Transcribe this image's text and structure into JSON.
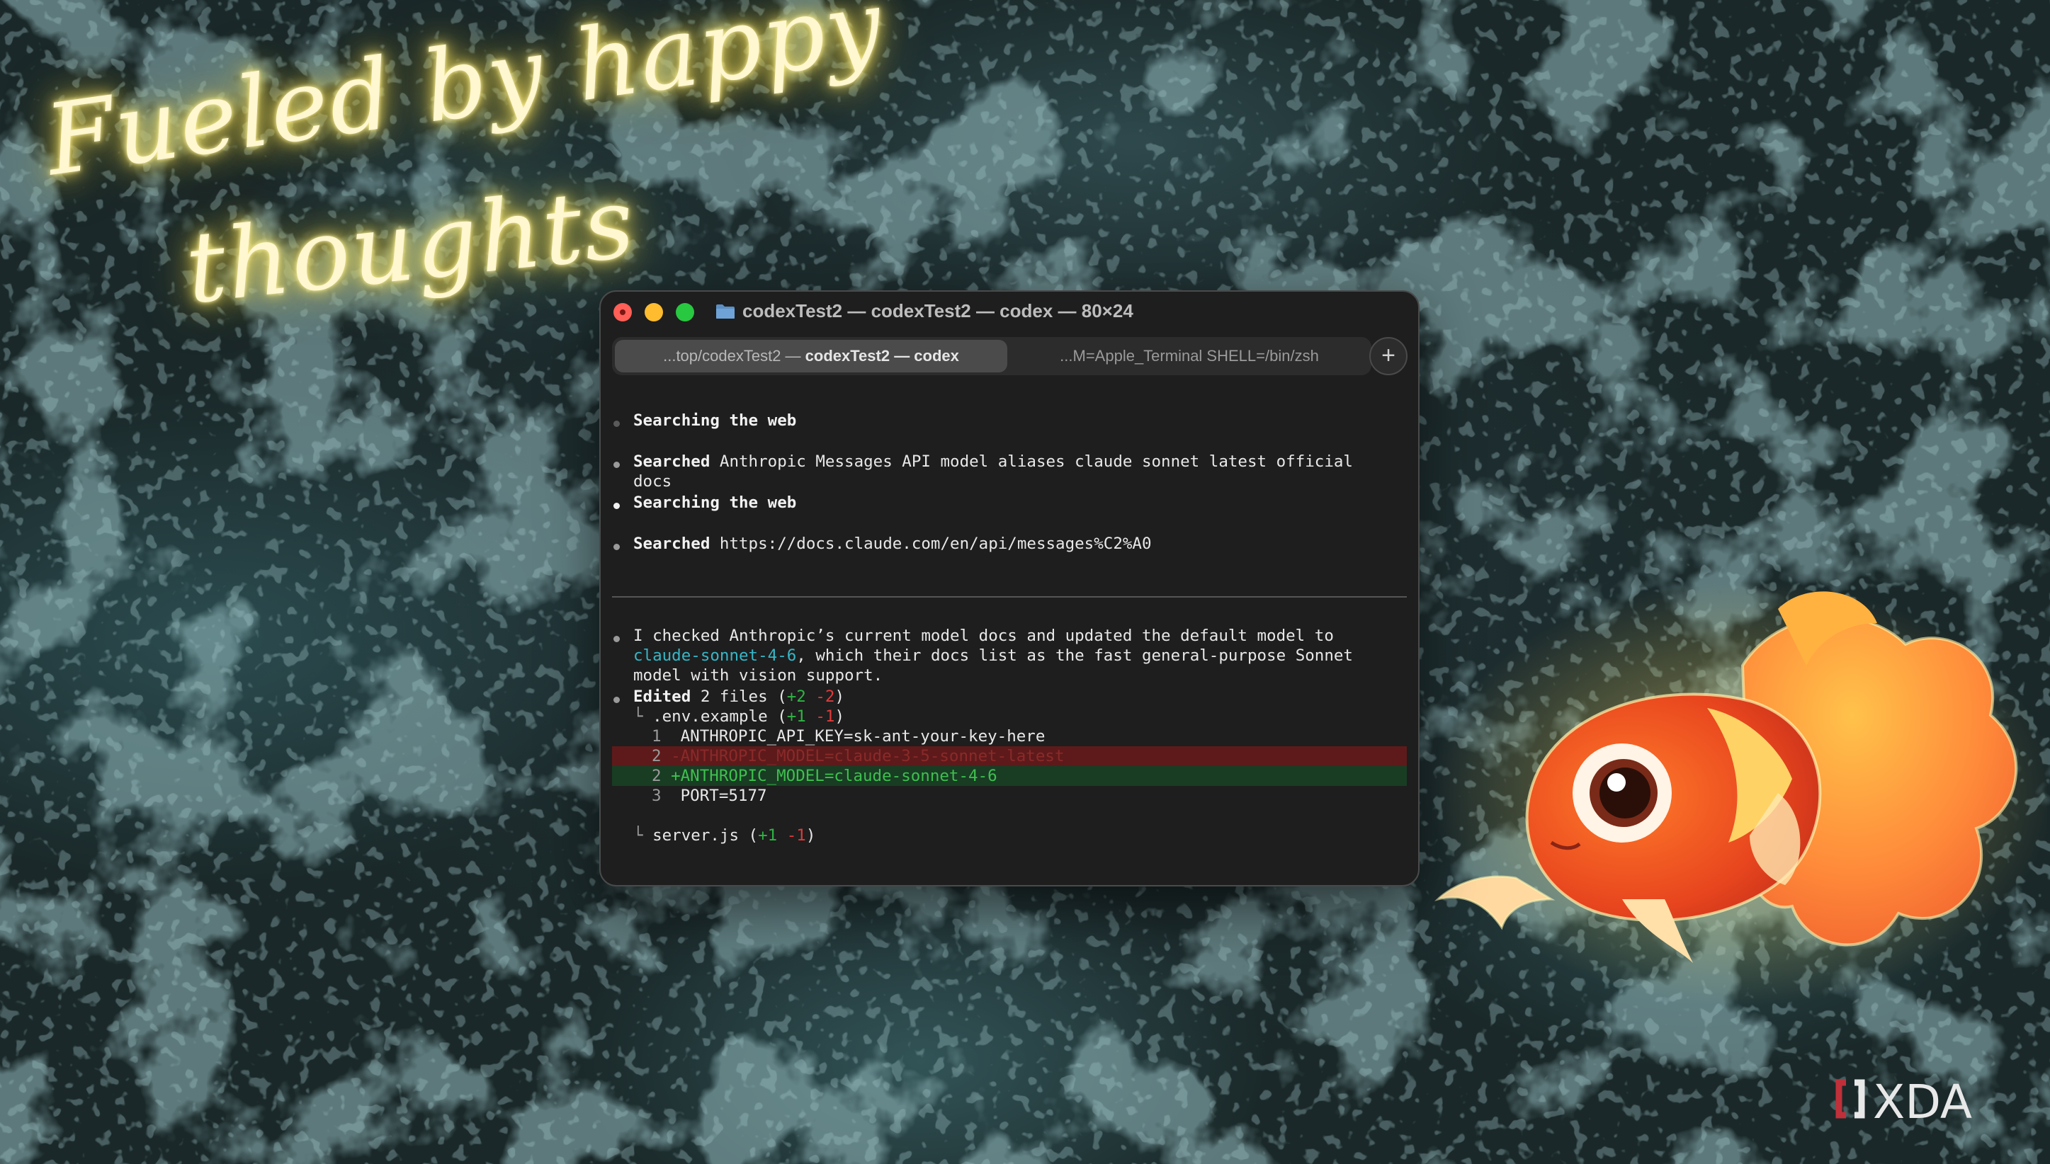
{
  "wallpaper": {
    "neon_line_1": "Fueled by happy",
    "neon_line_2": "thoughts",
    "watermark": "XDA"
  },
  "window": {
    "title": "codexTest2 — codexTest2 — codex — 80×24",
    "tabs": [
      {
        "prefix": "...top/codexTest2 — ",
        "label": "codexTest2 — codex",
        "active": true
      },
      {
        "label": "...M=Apple_Terminal SHELL=/bin/zsh",
        "active": false
      }
    ],
    "new_tab_label": "+"
  },
  "terminal": {
    "log": [
      {
        "bold": "Searching the web",
        "rest": ""
      },
      {
        "bold": "Searched",
        "rest": " Anthropic Messages API model aliases claude sonnet latest official",
        "cont": "docs"
      },
      {
        "bold": "Searching the web",
        "rest": ""
      },
      {
        "bold": "Searched",
        "rest": " https://docs.claude.com/en/api/messages%C2%A0"
      }
    ],
    "message": {
      "line1": "I checked Anthropic’s current model docs and updated the default model to",
      "model": "claude-sonnet-4-6",
      "line2_rest": ", which their docs list as the fast general-purpose Sonnet",
      "line3": "model with vision support."
    },
    "edit_summary": {
      "label": "Edited",
      "text": " 2 files (",
      "plus": "+2",
      "minus": "-2",
      "close": ")"
    },
    "file1": {
      "branch": "└ ",
      "name": ".env.example (",
      "plus": "+1",
      "minus": "-1",
      "close": ")"
    },
    "diff": [
      {
        "num": "1",
        "text": "  ANTHROPIC_API_KEY=sk-ant-your-key-here",
        "kind": "ctx"
      },
      {
        "num": "2",
        "text": " -ANTHROPIC_MODEL=claude-3-5-sonnet-latest",
        "kind": "del"
      },
      {
        "num": "2",
        "text": " +ANTHROPIC_MODEL=claude-sonnet-4-6",
        "kind": "add"
      },
      {
        "num": "3",
        "text": "  PORT=5177",
        "kind": "ctx"
      }
    ],
    "file2": {
      "branch": "└ ",
      "name": "server.js (",
      "plus": "+1",
      "minus": "-1",
      "close": ")"
    }
  },
  "colors": {
    "accent_cyan": "#36b7c7",
    "add_green": "#2fb344",
    "del_red": "#e03b3b"
  }
}
